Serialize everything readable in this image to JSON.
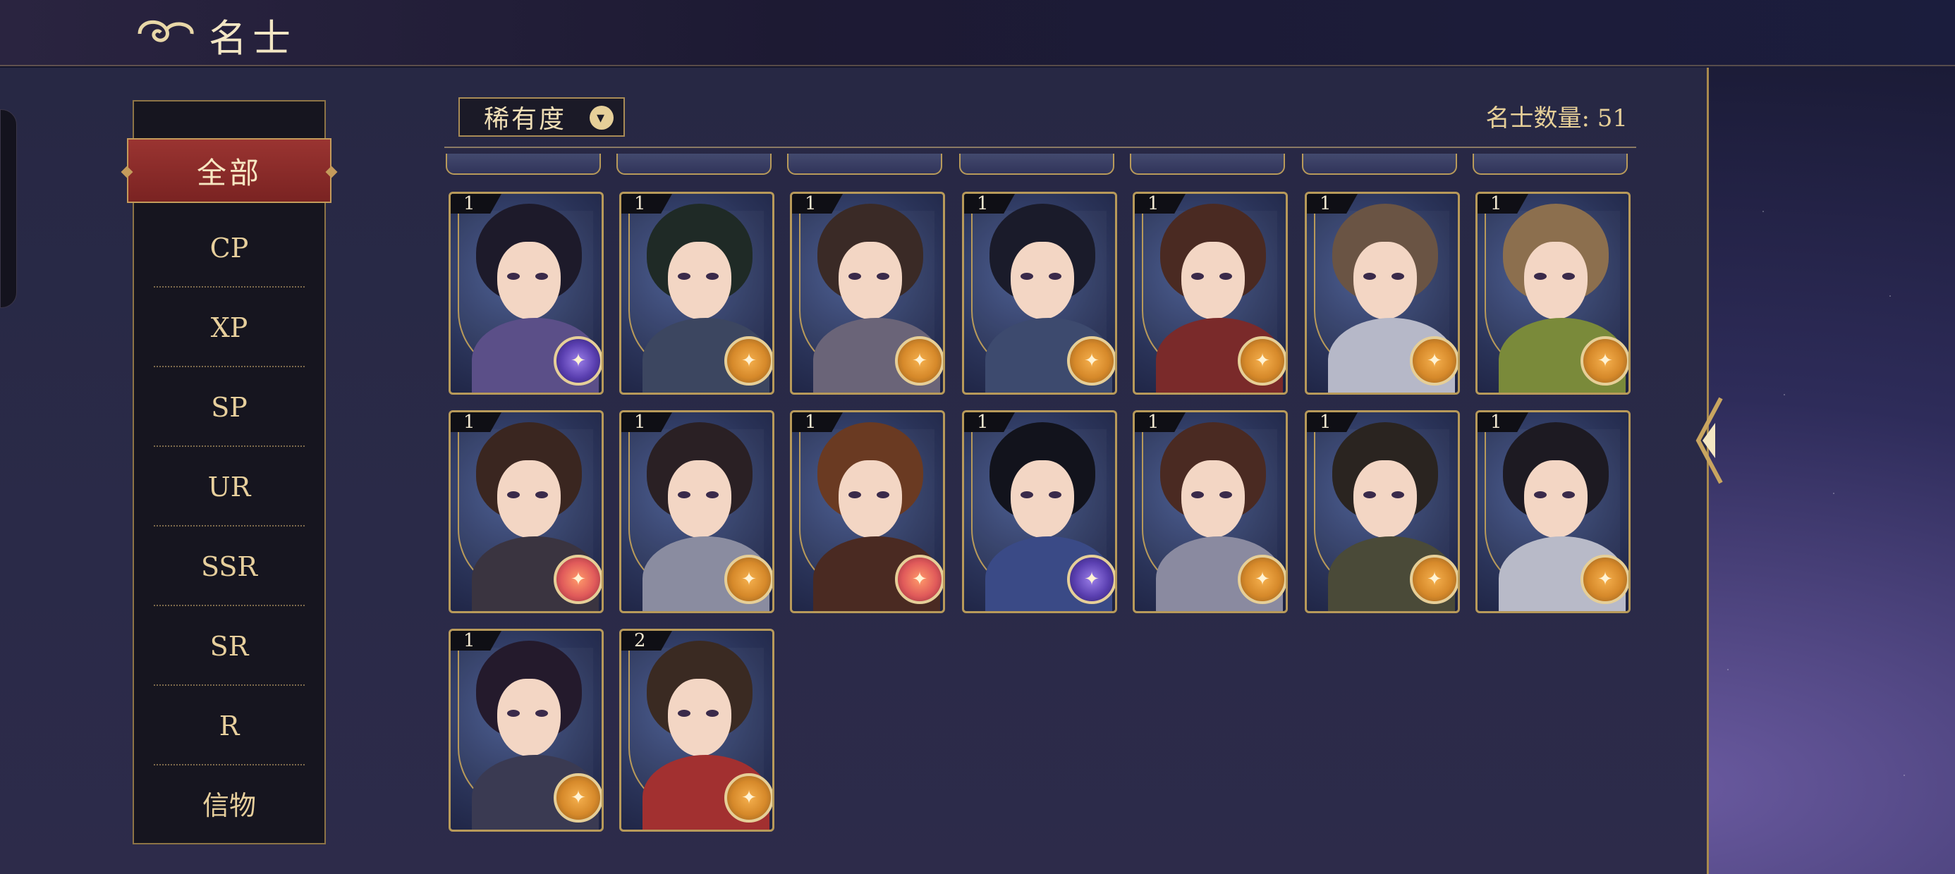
{
  "header": {
    "title": "名士",
    "title_icon": "cloud-swirl-icon"
  },
  "filter": {
    "label": "稀有度",
    "icon": "chevron-down-icon"
  },
  "collection": {
    "count_text": "名士数量: 51"
  },
  "menu": {
    "active": "全部",
    "items": [
      "CP",
      "XP",
      "SP",
      "UR",
      "SSR",
      "SR",
      "R",
      "信物"
    ]
  },
  "colors": {
    "accent_gold": "#b89a5a",
    "active_red": "#8a2b2a",
    "panel": "#272844"
  },
  "cards": [
    {
      "level": "1",
      "badge": "purple",
      "hair": "#1d1a2a",
      "body": "#5b4f88"
    },
    {
      "level": "1",
      "badge": "gold",
      "hair": "#1f2a26",
      "body": "#3c4660"
    },
    {
      "level": "1",
      "badge": "gold",
      "hair": "#3a2a26",
      "body": "#6a6478"
    },
    {
      "level": "1",
      "badge": "gold",
      "hair": "#1a1b2a",
      "body": "#3d4a6e"
    },
    {
      "level": "1",
      "badge": "gold",
      "hair": "#4a2a22",
      "body": "#7a2a2a"
    },
    {
      "level": "1",
      "badge": "gold",
      "hair": "#6a5444",
      "body": "#b6b8c8"
    },
    {
      "level": "1",
      "badge": "gold",
      "hair": "#8c6f4e",
      "body": "#7a8a3a"
    },
    {
      "level": "1",
      "badge": "red",
      "hair": "#3a2620",
      "body": "#3a3440"
    },
    {
      "level": "1",
      "badge": "gold",
      "hair": "#2a2024",
      "body": "#8a8ca0"
    },
    {
      "level": "1",
      "badge": "red",
      "hair": "#6a3a22",
      "body": "#4a2a22"
    },
    {
      "level": "1",
      "badge": "purple",
      "hair": "#12131c",
      "body": "#3a4a86"
    },
    {
      "level": "1",
      "badge": "gold",
      "hair": "#4a2a22",
      "body": "#8a8aa0"
    },
    {
      "level": "1",
      "badge": "gold",
      "hair": "#2a2420",
      "body": "#4a4a38"
    },
    {
      "level": "1",
      "badge": "gold",
      "hair": "#1d1a22",
      "body": "#b8bac8"
    },
    {
      "level": "1",
      "badge": "gold",
      "hair": "#241a2c",
      "body": "#3a3a52"
    },
    {
      "level": "2",
      "badge": "gold",
      "hair": "#3a2a22",
      "body": "#a23030"
    }
  ]
}
